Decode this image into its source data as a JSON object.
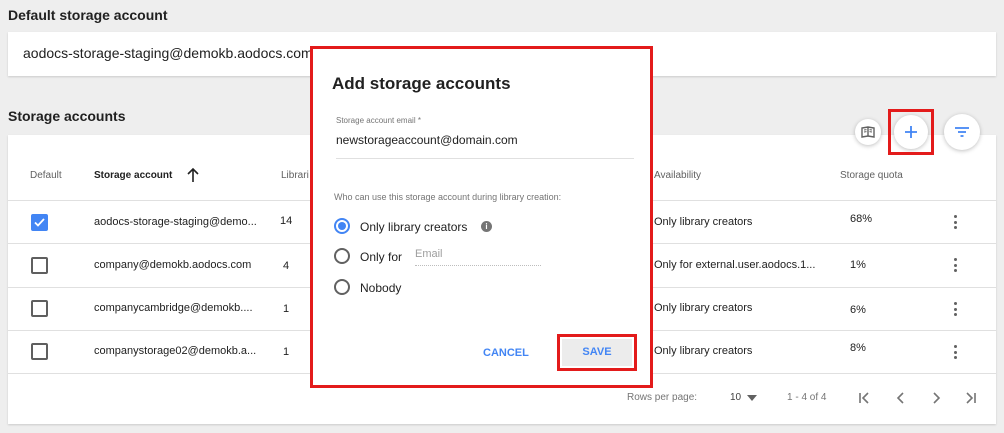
{
  "default_section": {
    "title": "Default storage account",
    "email": "aodocs-storage-staging@demokb.aodocs.com"
  },
  "storage_section": {
    "title": "Storage accounts"
  },
  "table": {
    "headers": {
      "default": "Default",
      "account": "Storage account",
      "libraries": "Libraries",
      "availability": "Availability",
      "quota": "Storage quota"
    },
    "rows": [
      {
        "checked": true,
        "account": "aodocs-storage-staging@demo...",
        "libraries": "14",
        "availability": "Only library creators",
        "quota": "68%"
      },
      {
        "checked": false,
        "account": "company@demokb.aodocs.com",
        "libraries": "4",
        "availability": "Only for external.user.aodocs.1...",
        "quota": "1%"
      },
      {
        "checked": false,
        "account": "companycambridge@demokb....",
        "libraries": "1",
        "availability": "Only library creators",
        "quota": "6%"
      },
      {
        "checked": false,
        "account": "companystorage02@demokb.a...",
        "libraries": "1",
        "availability": "Only library creators",
        "quota": "8%"
      }
    ]
  },
  "pagination": {
    "rows_per_page_label": "Rows per page:",
    "rows_per_page_value": "10",
    "range": "1 - 4 of 4"
  },
  "dialog": {
    "title": "Add storage accounts",
    "email_label": "Storage account email *",
    "email_value": "newstorageaccount@domain.com",
    "question": "Who can use this storage account during library creation:",
    "options": {
      "opt1": "Only library creators",
      "opt2": "Only for",
      "opt3": "Nobody"
    },
    "selected": "Only library creators",
    "email_placeholder": "Email",
    "cancel_label": "CANCEL",
    "save_label": "SAVE"
  },
  "colors": {
    "accent": "#4285f4",
    "highlight": "#e31b1b"
  },
  "icons": [
    "book-icon",
    "add-icon",
    "filter-icon",
    "sort-arrow-up-icon",
    "info-icon",
    "kebab-icon",
    "first-page-icon",
    "prev-page-icon",
    "next-page-icon",
    "last-page-icon",
    "dropdown-caret-icon"
  ]
}
